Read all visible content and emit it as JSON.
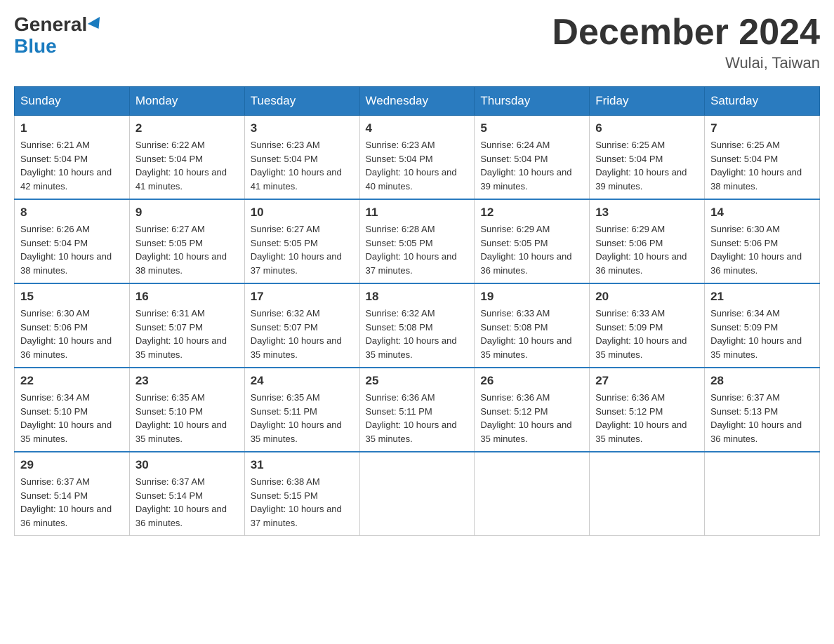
{
  "header": {
    "logo_general": "General",
    "logo_blue": "Blue",
    "month_title": "December 2024",
    "location": "Wulai, Taiwan"
  },
  "weekdays": [
    "Sunday",
    "Monday",
    "Tuesday",
    "Wednesday",
    "Thursday",
    "Friday",
    "Saturday"
  ],
  "weeks": [
    [
      {
        "day": "1",
        "sunrise": "6:21 AM",
        "sunset": "5:04 PM",
        "daylight": "10 hours and 42 minutes."
      },
      {
        "day": "2",
        "sunrise": "6:22 AM",
        "sunset": "5:04 PM",
        "daylight": "10 hours and 41 minutes."
      },
      {
        "day": "3",
        "sunrise": "6:23 AM",
        "sunset": "5:04 PM",
        "daylight": "10 hours and 41 minutes."
      },
      {
        "day": "4",
        "sunrise": "6:23 AM",
        "sunset": "5:04 PM",
        "daylight": "10 hours and 40 minutes."
      },
      {
        "day": "5",
        "sunrise": "6:24 AM",
        "sunset": "5:04 PM",
        "daylight": "10 hours and 39 minutes."
      },
      {
        "day": "6",
        "sunrise": "6:25 AM",
        "sunset": "5:04 PM",
        "daylight": "10 hours and 39 minutes."
      },
      {
        "day": "7",
        "sunrise": "6:25 AM",
        "sunset": "5:04 PM",
        "daylight": "10 hours and 38 minutes."
      }
    ],
    [
      {
        "day": "8",
        "sunrise": "6:26 AM",
        "sunset": "5:04 PM",
        "daylight": "10 hours and 38 minutes."
      },
      {
        "day": "9",
        "sunrise": "6:27 AM",
        "sunset": "5:05 PM",
        "daylight": "10 hours and 38 minutes."
      },
      {
        "day": "10",
        "sunrise": "6:27 AM",
        "sunset": "5:05 PM",
        "daylight": "10 hours and 37 minutes."
      },
      {
        "day": "11",
        "sunrise": "6:28 AM",
        "sunset": "5:05 PM",
        "daylight": "10 hours and 37 minutes."
      },
      {
        "day": "12",
        "sunrise": "6:29 AM",
        "sunset": "5:05 PM",
        "daylight": "10 hours and 36 minutes."
      },
      {
        "day": "13",
        "sunrise": "6:29 AM",
        "sunset": "5:06 PM",
        "daylight": "10 hours and 36 minutes."
      },
      {
        "day": "14",
        "sunrise": "6:30 AM",
        "sunset": "5:06 PM",
        "daylight": "10 hours and 36 minutes."
      }
    ],
    [
      {
        "day": "15",
        "sunrise": "6:30 AM",
        "sunset": "5:06 PM",
        "daylight": "10 hours and 36 minutes."
      },
      {
        "day": "16",
        "sunrise": "6:31 AM",
        "sunset": "5:07 PM",
        "daylight": "10 hours and 35 minutes."
      },
      {
        "day": "17",
        "sunrise": "6:32 AM",
        "sunset": "5:07 PM",
        "daylight": "10 hours and 35 minutes."
      },
      {
        "day": "18",
        "sunrise": "6:32 AM",
        "sunset": "5:08 PM",
        "daylight": "10 hours and 35 minutes."
      },
      {
        "day": "19",
        "sunrise": "6:33 AM",
        "sunset": "5:08 PM",
        "daylight": "10 hours and 35 minutes."
      },
      {
        "day": "20",
        "sunrise": "6:33 AM",
        "sunset": "5:09 PM",
        "daylight": "10 hours and 35 minutes."
      },
      {
        "day": "21",
        "sunrise": "6:34 AM",
        "sunset": "5:09 PM",
        "daylight": "10 hours and 35 minutes."
      }
    ],
    [
      {
        "day": "22",
        "sunrise": "6:34 AM",
        "sunset": "5:10 PM",
        "daylight": "10 hours and 35 minutes."
      },
      {
        "day": "23",
        "sunrise": "6:35 AM",
        "sunset": "5:10 PM",
        "daylight": "10 hours and 35 minutes."
      },
      {
        "day": "24",
        "sunrise": "6:35 AM",
        "sunset": "5:11 PM",
        "daylight": "10 hours and 35 minutes."
      },
      {
        "day": "25",
        "sunrise": "6:36 AM",
        "sunset": "5:11 PM",
        "daylight": "10 hours and 35 minutes."
      },
      {
        "day": "26",
        "sunrise": "6:36 AM",
        "sunset": "5:12 PM",
        "daylight": "10 hours and 35 minutes."
      },
      {
        "day": "27",
        "sunrise": "6:36 AM",
        "sunset": "5:12 PM",
        "daylight": "10 hours and 35 minutes."
      },
      {
        "day": "28",
        "sunrise": "6:37 AM",
        "sunset": "5:13 PM",
        "daylight": "10 hours and 36 minutes."
      }
    ],
    [
      {
        "day": "29",
        "sunrise": "6:37 AM",
        "sunset": "5:14 PM",
        "daylight": "10 hours and 36 minutes."
      },
      {
        "day": "30",
        "sunrise": "6:37 AM",
        "sunset": "5:14 PM",
        "daylight": "10 hours and 36 minutes."
      },
      {
        "day": "31",
        "sunrise": "6:38 AM",
        "sunset": "5:15 PM",
        "daylight": "10 hours and 37 minutes."
      },
      null,
      null,
      null,
      null
    ]
  ]
}
